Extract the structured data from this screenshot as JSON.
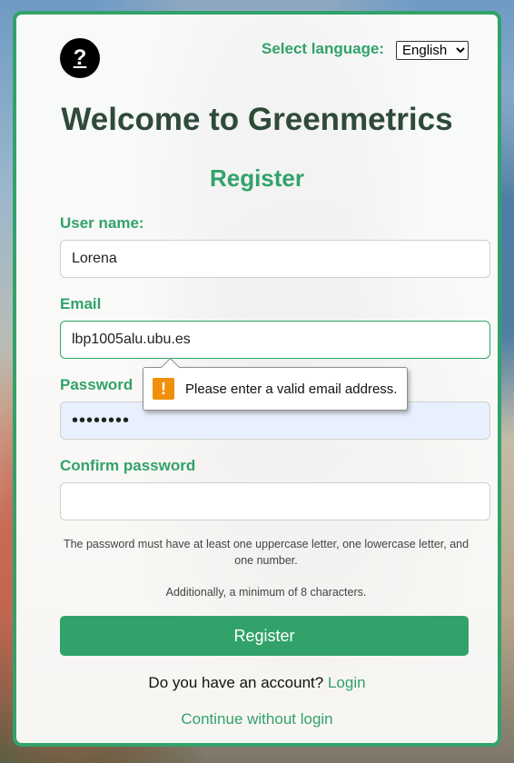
{
  "header": {
    "help_label": "?",
    "language_label": "Select language:",
    "language_value": "English"
  },
  "title": "Welcome to Greenmetrics",
  "subtitle": "Register",
  "form": {
    "username_label": "User name:",
    "username_value": "Lorena",
    "email_label": "Email",
    "email_value": "lbp1005alu.ubu.es",
    "password_label": "Password",
    "password_value": "••••••••",
    "confirm_label": "Confirm password",
    "confirm_value": "",
    "hint_1": "The password must have at least one uppercase letter, one lowercase letter, and one number.",
    "hint_2": "Additionally, a minimum of 8 characters.",
    "register_label": "Register"
  },
  "validation": {
    "icon": "!",
    "message": "Please enter a valid email address."
  },
  "footer": {
    "account_text": "Do you have an account?",
    "login_link": "Login",
    "continue_link": "Continue without login"
  },
  "colors": {
    "accent": "#32a26a",
    "title": "#2f4a38",
    "warning": "#f0900a",
    "autofill": "#e8f0fe"
  }
}
